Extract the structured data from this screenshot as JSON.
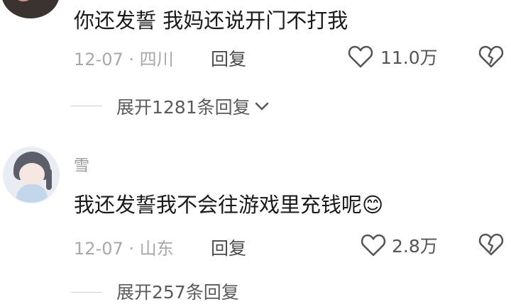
{
  "comments": [
    {
      "text": "你还发誓 我妈还说开门不打我",
      "date": "12-07",
      "location": "四川",
      "reply_label": "回复",
      "likes": "11.0万",
      "expand_label": "展开1281条回复"
    },
    {
      "username": "雪",
      "text": "我还发誓我不会往游戏里充钱呢",
      "emoji": "😊",
      "date": "12-07",
      "location": "山东",
      "reply_label": "回复",
      "likes": "2.8万",
      "expand_label": "展开257条回复"
    }
  ],
  "meta_separator": "·",
  "icons": [
    "heart-outline-icon",
    "broken-heart-icon",
    "chevron-down-icon",
    "smiling-emoji-icon"
  ],
  "colors": {
    "text": "#1a1a1a",
    "meta": "#a8a8a8",
    "icon": "#555555"
  }
}
